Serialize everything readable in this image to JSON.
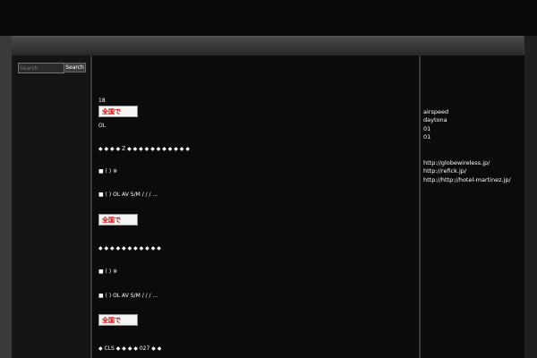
{
  "header": {
    "site_title": ""
  },
  "nav": {
    "home_label": ""
  },
  "sidebar_left": {
    "search_placeholder": "Search",
    "search_button": "Search"
  },
  "main": {
    "page_title": "",
    "intro_line1": "",
    "intro_line2": "18",
    "banner_label": "全国で",
    "desc": "OL",
    "section1_heading": "",
    "section1_list": "◆ ◆ ◆ ◆ Z ◆ ◆ ◆ ◆ ◆ ◆ ◆ ◆ ◆ ◆ ◆",
    "section1_para1": "■ ( ) ※",
    "section1_para2": "■ ( ) OL AV S/M / / / ...",
    "section2_heading": "",
    "section2_list": "◆ ◆ ◆ ◆ ◆ ◆ ◆ ◆ ◆ ◆ ◆",
    "section2_para1": "■ ( ) ※",
    "section2_para2": "■ ( ) OL AV S/M / / / ...",
    "section3_heading": "",
    "section3_list": "◆ CLS ◆ ◆ ◆ ◆ 027 ◆ ◆"
  },
  "sidebar_right": {
    "links": [
      "",
      "",
      "",
      "",
      "",
      "",
      "airspeed",
      "daytona",
      "01",
      "01",
      "",
      "",
      "http://globewireless.jp/",
      "http://refick.jp/",
      "http://http://hotel-martinez.jp/"
    ]
  }
}
